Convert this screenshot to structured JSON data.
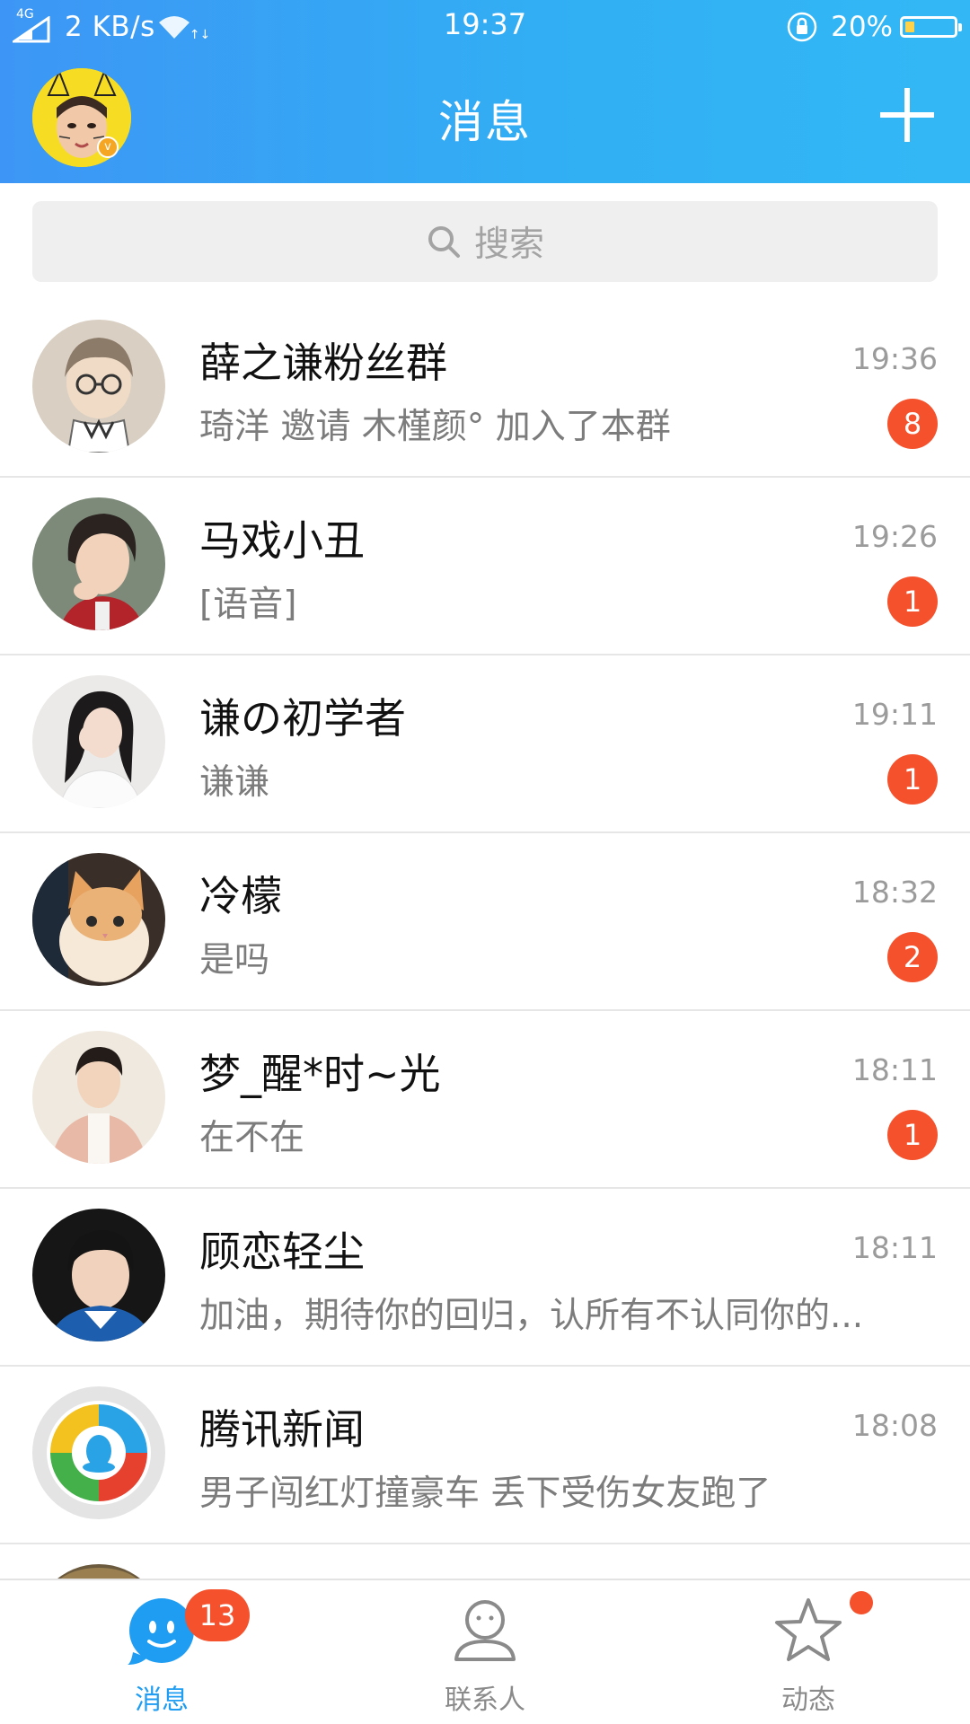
{
  "status_bar": {
    "network": "4G",
    "speed": "2 KB/s",
    "time": "19:37",
    "battery": "20%",
    "battery_level": 0.2
  },
  "header": {
    "title": "消息"
  },
  "search": {
    "placeholder": "搜索"
  },
  "conversations": [
    {
      "name": "薛之谦粉丝群",
      "preview": "琦洋 邀请 木槿颜° 加入了本群",
      "time": "19:36",
      "badge": "8"
    },
    {
      "name": "马戏小丑",
      "preview": "[语音]",
      "time": "19:26",
      "badge": "1"
    },
    {
      "name": "谦の初学者",
      "preview": "谦谦",
      "time": "19:11",
      "badge": "1"
    },
    {
      "name": "冷檬",
      "preview": "是吗",
      "time": "18:32",
      "badge": "2"
    },
    {
      "name": "梦_醒*时~光",
      "preview": "在不在",
      "time": "18:11",
      "badge": "1"
    },
    {
      "name": "顾恋轻尘",
      "preview": "加油，期待你的回归，认所有不认同你的...",
      "time": "18:11",
      "badge": ""
    },
    {
      "name": "腾讯新闻",
      "preview": "男子闯红灯撞豪车 丢下受伤女友跑了",
      "time": "18:08",
      "badge": ""
    }
  ],
  "tabbar": {
    "messages": {
      "label": "消息",
      "badge": "13"
    },
    "contacts": {
      "label": "联系人"
    },
    "moments": {
      "label": "动态"
    }
  },
  "colors": {
    "header_start": "#3d96f5",
    "header_end": "#33b8f5",
    "badge": "#f4512c",
    "active_tab": "#1f9df2"
  }
}
